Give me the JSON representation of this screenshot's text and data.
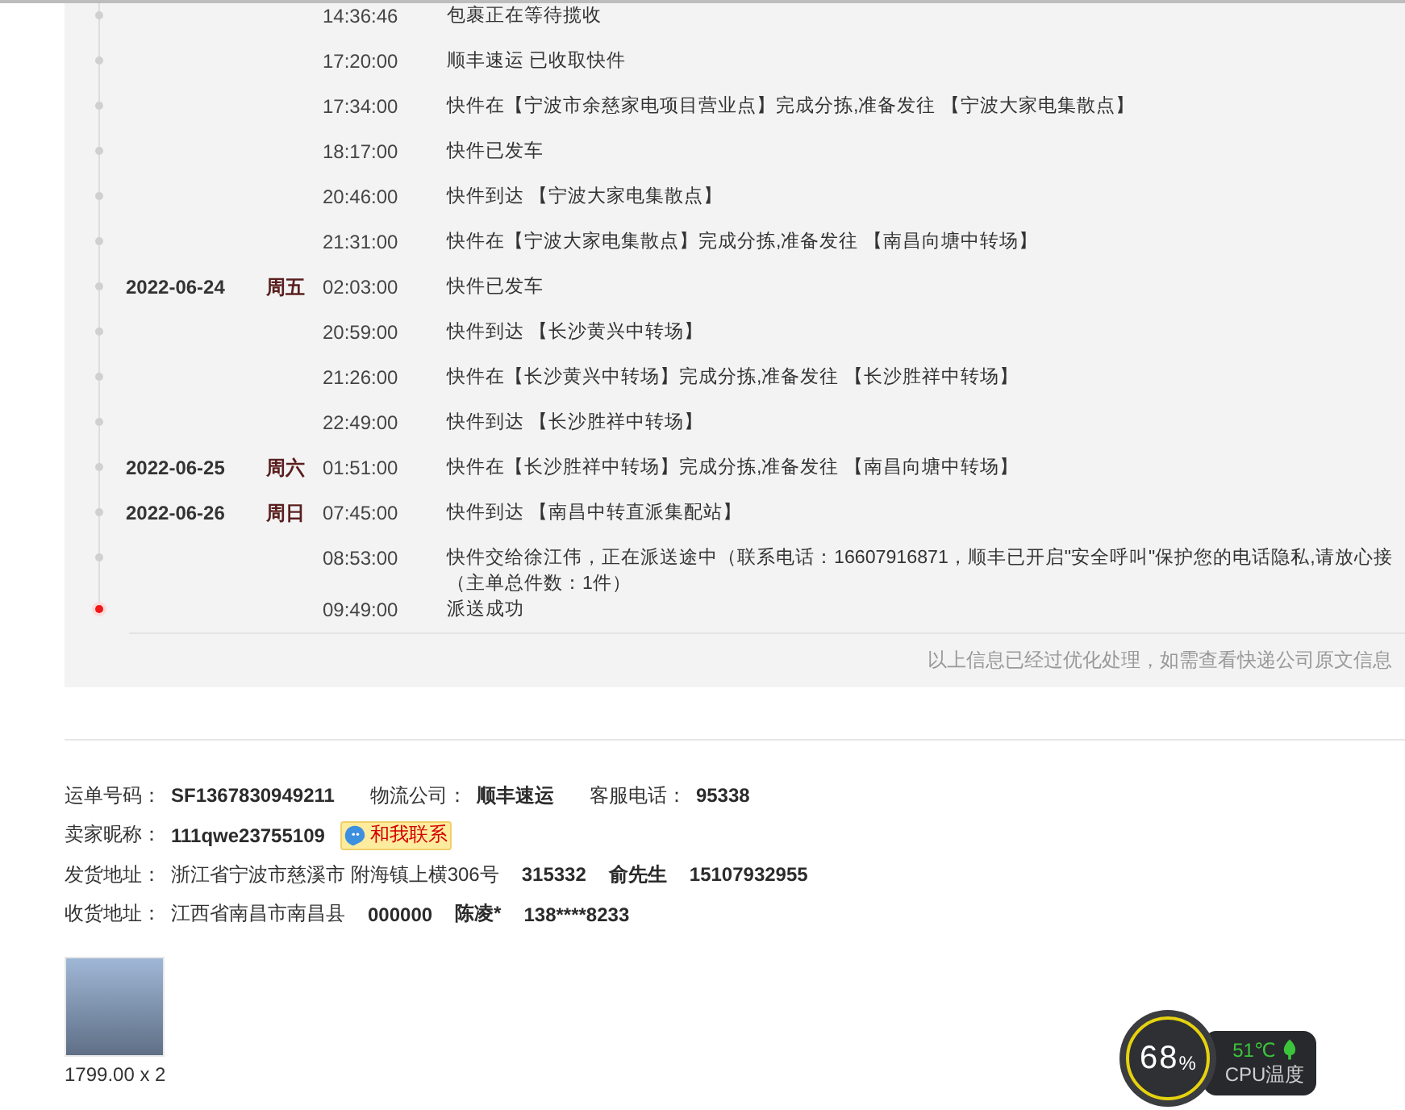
{
  "timeline": [
    {
      "time": "14:36:46",
      "lines": [
        "包裹正在等待揽收"
      ],
      "current": false
    },
    {
      "time": "17:20:00",
      "lines": [
        "顺丰速运 已收取快件"
      ],
      "current": false
    },
    {
      "time": "17:34:00",
      "lines": [
        "快件在【宁波市余慈家电项目营业点】完成分拣,准备发往 【宁波大家电集散点】"
      ],
      "current": false
    },
    {
      "time": "18:17:00",
      "lines": [
        "快件已发车"
      ],
      "current": false
    },
    {
      "time": "20:46:00",
      "lines": [
        "快件到达 【宁波大家电集散点】"
      ],
      "current": false
    },
    {
      "time": "21:31:00",
      "lines": [
        "快件在【宁波大家电集散点】完成分拣,准备发往 【南昌向塘中转场】"
      ],
      "current": false
    },
    {
      "date": "2022-06-24",
      "weekday": "周五",
      "time": "02:03:00",
      "lines": [
        "快件已发车"
      ],
      "current": false
    },
    {
      "time": "20:59:00",
      "lines": [
        "快件到达 【长沙黄兴中转场】"
      ],
      "current": false
    },
    {
      "time": "21:26:00",
      "lines": [
        "快件在【长沙黄兴中转场】完成分拣,准备发往 【长沙胜祥中转场】"
      ],
      "current": false
    },
    {
      "time": "22:49:00",
      "lines": [
        "快件到达 【长沙胜祥中转场】"
      ],
      "current": false
    },
    {
      "date": "2022-06-25",
      "weekday": "周六",
      "time": "01:51:00",
      "lines": [
        "快件在【长沙胜祥中转场】完成分拣,准备发往 【南昌向塘中转场】"
      ],
      "current": false
    },
    {
      "date": "2022-06-26",
      "weekday": "周日",
      "time": "07:45:00",
      "lines": [
        "快件到达 【南昌中转直派集配站】"
      ],
      "current": false
    },
    {
      "time": "08:53:00",
      "lines": [
        "快件交给徐江伟，正在派送途中（联系电话：16607916871，顺丰已开启\"安全呼叫\"保护您的电话隐私,请放心接",
        "（主单总件数：1件）"
      ],
      "current": false
    },
    {
      "time": "09:49:00",
      "lines": [
        "派送成功"
      ],
      "current": true
    }
  ],
  "timeline_note": "以上信息已经过优化处理，如需查看快递公司原文信息",
  "info_rows": [
    [
      {
        "label": "运单号码：",
        "value": "SF1367830949211"
      },
      {
        "label": "物流公司：",
        "value": "顺丰速运"
      },
      {
        "label": "客服电话：",
        "value": "95338"
      }
    ],
    [
      {
        "label": "卖家昵称：",
        "value": "111qwe23755109"
      }
    ],
    [
      {
        "label": "发货地址：",
        "value": "浙江省宁波市慈溪市 附海镇上横306号",
        "extra": [
          "315332",
          "俞先生",
          "15107932955"
        ]
      }
    ],
    [
      {
        "label": "收货地址：",
        "value": "江西省南昌市南昌县",
        "extra": [
          "000000",
          "陈凌*",
          "138****8233"
        ]
      }
    ]
  ],
  "contact_button": "和我联系",
  "product": {
    "price": "1799.00 x 2"
  },
  "cpu_widget": {
    "usage": "68",
    "unit": "%",
    "temperature": "51℃",
    "label": "CPU温度"
  }
}
